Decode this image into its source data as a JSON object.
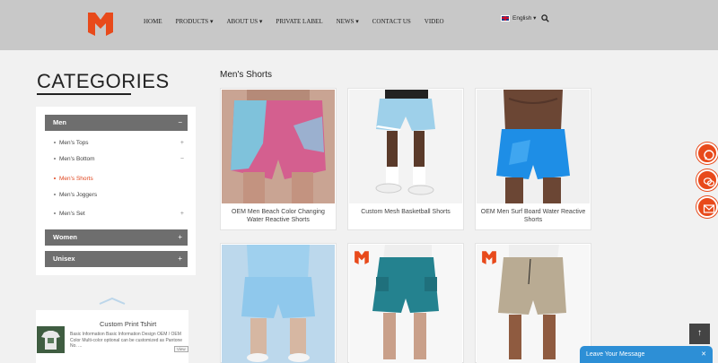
{
  "header": {
    "nav": [
      "HOME",
      "PRODUCTS ▾",
      "ABOUT US ▾",
      "PRIVATE LABEL",
      "NEWS ▾",
      "CONTACT US",
      "VIDEO"
    ],
    "language": "English ▾"
  },
  "sidebar": {
    "title": "CATEGORIES",
    "groups": {
      "men": {
        "label": "Men",
        "sign": "−"
      },
      "women": {
        "label": "Women",
        "sign": "+"
      },
      "unisex": {
        "label": "Unisex",
        "sign": "+"
      }
    },
    "men_items": [
      {
        "label": "Men's Tops",
        "sign": "+"
      },
      {
        "label": "Men's Bottom",
        "sign": "−"
      },
      {
        "label": "Men's Shorts",
        "sign": ""
      },
      {
        "label": "Men's Joggers",
        "sign": ""
      },
      {
        "label": "Men's Set",
        "sign": "+"
      }
    ],
    "featured": {
      "title": "Custom Print Tshirt",
      "description": "Basic Information Basic Information Design OEM / OEM Color Multi-color optional can be customized as Pantone No. ...",
      "more": "View"
    }
  },
  "main": {
    "title": "Men's Shorts",
    "products": [
      {
        "caption": "OEM Men Beach Color Changing Water Reactive Shorts"
      },
      {
        "caption": "Custom Mesh Basketball Shorts"
      },
      {
        "caption": "OEM Men Surf Board Water Reactive Shorts"
      },
      {
        "caption": ""
      },
      {
        "caption": ""
      },
      {
        "caption": ""
      }
    ]
  },
  "widgets": {
    "scroll_top": "↑",
    "leave_message": "Leave Your Message",
    "close": "✕"
  },
  "colors": {
    "accent": "#e84a1b",
    "header": "#c8c8c8",
    "category_head": "#6e6e6e",
    "message_bar": "#2d8fd6"
  }
}
